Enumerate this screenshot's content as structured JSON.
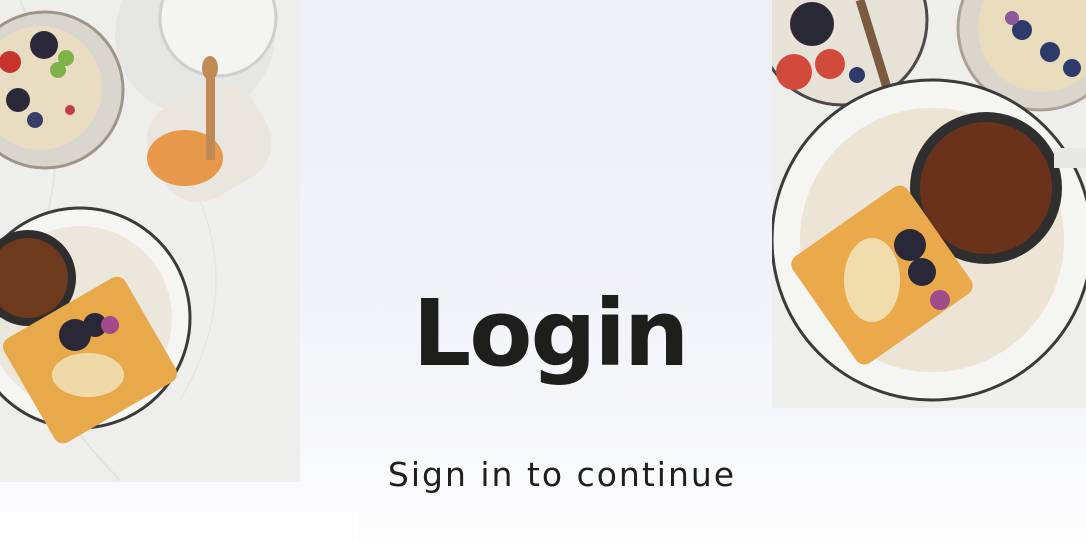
{
  "login": {
    "title": "Login",
    "subtitle": "Sign in to continue"
  },
  "images": {
    "left": "breakfast-table-photo",
    "right": "waffle-coffee-photo"
  },
  "colors": {
    "title": "#1e1e1c",
    "background": "#f1f2f6"
  }
}
